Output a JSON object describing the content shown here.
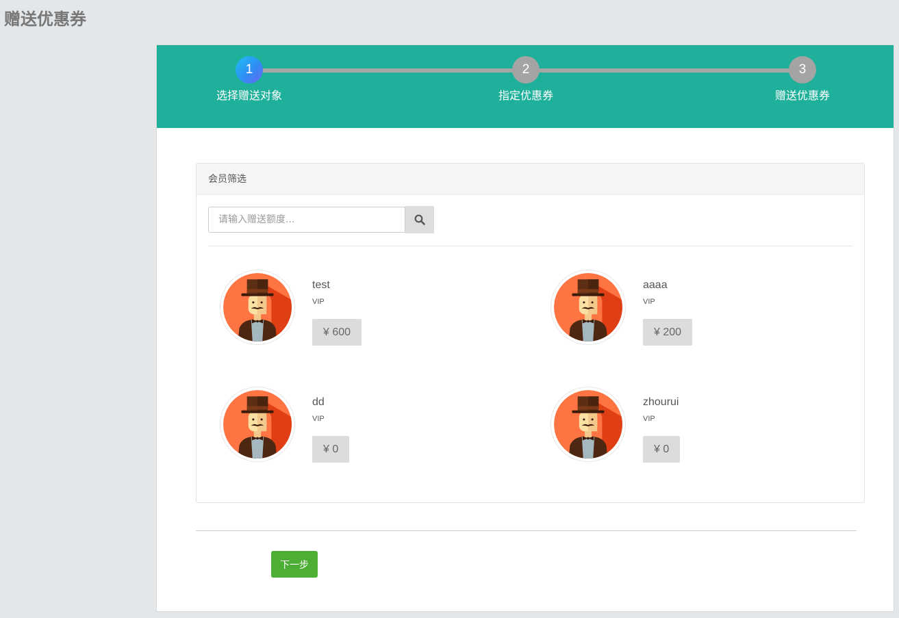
{
  "page": {
    "title": "赠送优惠券"
  },
  "steps": [
    {
      "number": "1",
      "label": "选择赠送对象",
      "active": true
    },
    {
      "number": "2",
      "label": "指定优惠券",
      "active": false
    },
    {
      "number": "3",
      "label": "赠送优惠券",
      "active": false
    }
  ],
  "filter_panel": {
    "heading": "会员筛选",
    "search": {
      "placeholder": "请输入赠送额度...",
      "value": "",
      "icon": "search-icon"
    }
  },
  "members": [
    {
      "name": "test",
      "level": "VIP",
      "balance": "¥ 600",
      "avatar": "gentleman-avatar"
    },
    {
      "name": "aaaa",
      "level": "VIP",
      "balance": "¥ 200",
      "avatar": "gentleman-avatar"
    },
    {
      "name": "dd",
      "level": "VIP",
      "balance": "¥ 0",
      "avatar": "gentleman-avatar"
    },
    {
      "name": "zhourui",
      "level": "VIP",
      "balance": "¥ 0",
      "avatar": "gentleman-avatar"
    }
  ],
  "actions": {
    "next_label": "下一步"
  },
  "colors": {
    "header_bg": "#1eb09a",
    "step_inactive": "#a4a4a4",
    "next_button": "#4cae34",
    "page_bg": "#e4e7ea"
  }
}
